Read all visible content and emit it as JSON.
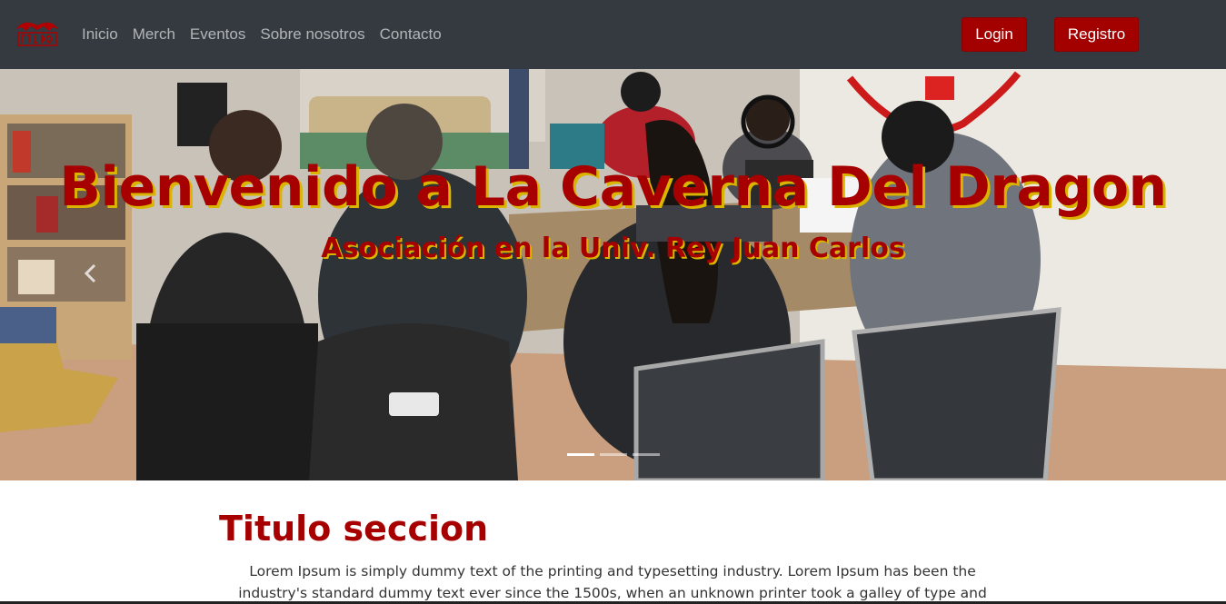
{
  "navbar": {
    "logo_icon": "dragon-logo-icon",
    "links": [
      "Inicio",
      "Merch",
      "Eventos",
      "Sobre nosotros",
      "Contacto"
    ],
    "login_label": "Login",
    "register_label": "Registro",
    "colors": {
      "background": "#343a40",
      "button": "#a30000"
    }
  },
  "hero": {
    "title": "Bienvenido a La Caverna Del Dragon",
    "subtitle": "Asociación en la Univ. Rey Juan Carlos",
    "prev_icon": "chevron-left-icon",
    "slides": 3,
    "active_slide": 1,
    "colors": {
      "text": "#a60000",
      "shadow": "#d9b400"
    }
  },
  "section": {
    "title": "Titulo seccion",
    "text": "Lorem Ipsum is simply dummy text of the printing and typesetting industry. Lorem Ipsum has been the industry's standard dummy text ever since the 1500s, when an unknown printer took a galley of type and"
  }
}
